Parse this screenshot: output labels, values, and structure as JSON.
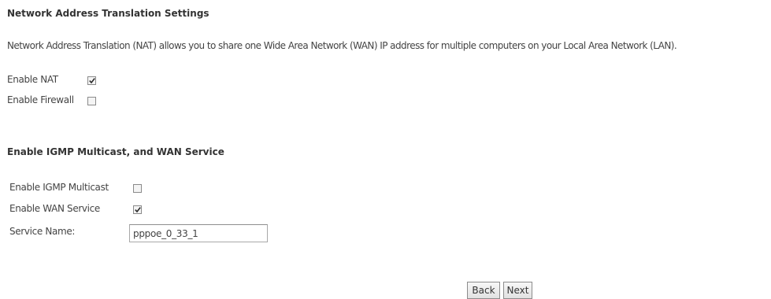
{
  "nat_section": {
    "title": "Network Address Translation Settings",
    "description": "Network Address Translation (NAT) allows you to share one Wide Area Network (WAN) IP address for multiple computers on your Local Area Network (LAN).",
    "enable_nat": {
      "label": "Enable NAT",
      "checked": true
    },
    "enable_firewall": {
      "label": "Enable Firewall",
      "checked": false
    }
  },
  "igmp_section": {
    "title": "Enable IGMP Multicast, and WAN Service",
    "enable_igmp": {
      "label": "Enable IGMP Multicast",
      "checked": false
    },
    "enable_wan_service": {
      "label": "Enable WAN Service",
      "checked": true
    },
    "service_name": {
      "label": "Service Name:",
      "value": "pppoe_0_33_1"
    }
  },
  "buttons": {
    "back": "Back",
    "next": "Next"
  },
  "colors": {
    "tick": "#2a2a2a",
    "checkbox_border": "#8a8a8a"
  }
}
